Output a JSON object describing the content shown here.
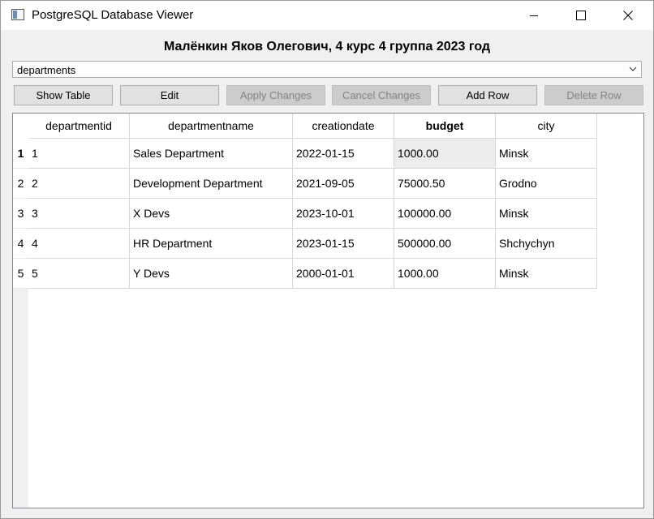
{
  "window": {
    "title": "PostgreSQL Database Viewer"
  },
  "heading": "Малёнкин Яков Олегович, 4 курс 4 группа 2023 год",
  "table_select": {
    "value": "departments"
  },
  "toolbar": {
    "show_table": "Show Table",
    "edit": "Edit",
    "apply_changes": "Apply Changes",
    "cancel_changes": "Cancel Changes",
    "add_row": "Add Row",
    "delete_row": "Delete Row"
  },
  "table": {
    "columns": [
      "departmentid",
      "departmentname",
      "creationdate",
      "budget",
      "city"
    ],
    "row_numbers": [
      "1",
      "2",
      "3",
      "4",
      "5"
    ],
    "rows": [
      [
        "1",
        "Sales Department",
        "2022-01-15",
        "1000.00",
        "Minsk"
      ],
      [
        "2",
        "Development Department",
        "2021-09-05",
        "75000.50",
        "Grodno"
      ],
      [
        "3",
        "X Devs",
        "2023-10-01",
        "100000.00",
        "Minsk"
      ],
      [
        "4",
        "HR Department",
        "2023-01-15",
        "500000.00",
        "Shchychyn"
      ],
      [
        "5",
        "Y Devs",
        "2000-01-01",
        "1000.00",
        "Minsk"
      ]
    ],
    "current_column": "budget",
    "current_row": "1"
  },
  "icons": {
    "app": "window-app-icon",
    "minimize": "minimize-icon",
    "maximize": "maximize-icon",
    "close": "close-icon",
    "dropdown": "chevron-down-icon"
  }
}
